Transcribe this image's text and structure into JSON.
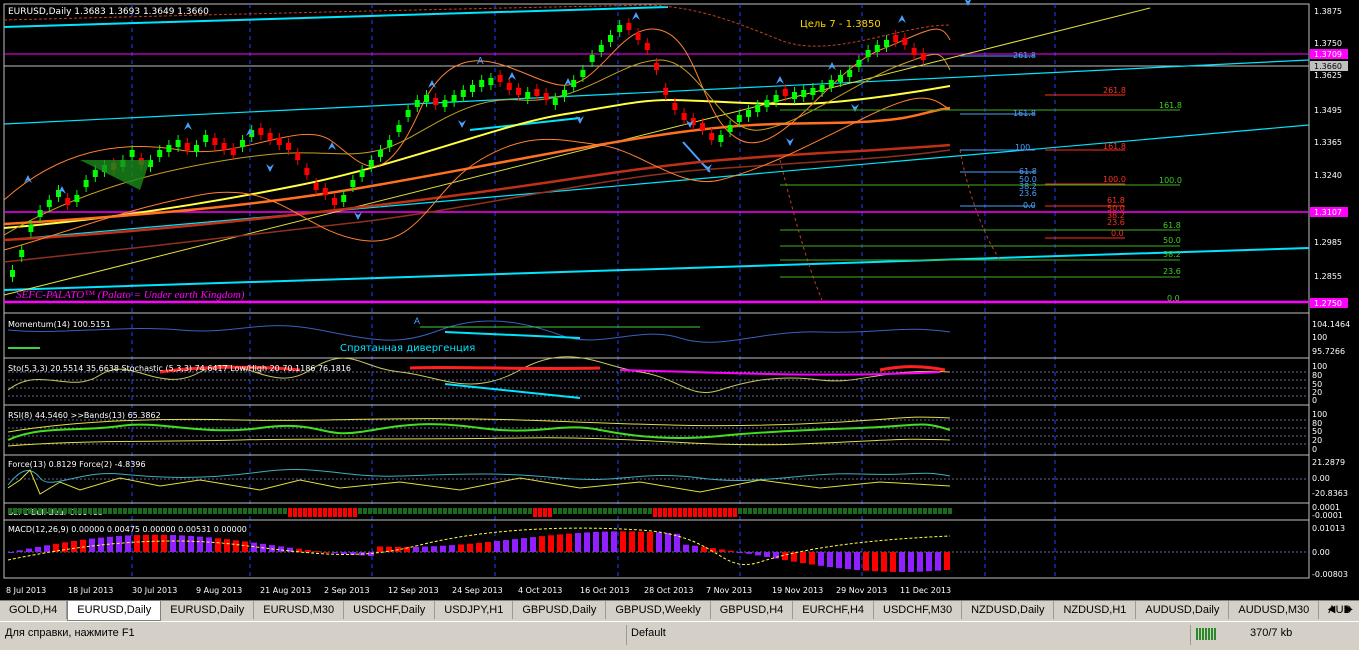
{
  "window": {
    "symbol_header": "EURUSD,Daily  1.3683 1.3693 1.3649 1.3660",
    "target_label": "Цель 7 - 1.3850",
    "watermark": "SEFC-PALATO™ (Palato = Under earth Kingdom)"
  },
  "price_axis": {
    "ticks": [
      "1.3875",
      "1.3750",
      "1.3625",
      "1.3495",
      "1.3365",
      "1.3240",
      "1.2985",
      "1.2855"
    ],
    "boxes": [
      {
        "label": "1.3709",
        "color": "#ff00ff"
      },
      {
        "label": "1.3660",
        "color": "#c0c0c0"
      },
      {
        "label": "1.3107",
        "color": "#ff00ff"
      },
      {
        "label": "1.2750",
        "color": "#ff00ff"
      }
    ]
  },
  "fib_labels": {
    "blue": [
      "261.8",
      "161.8",
      "100",
      "61.8",
      "50.0",
      "38.2",
      "23.6",
      "0.0"
    ],
    "red": [
      "261.8",
      "161.8",
      "100.0",
      "61.8",
      "50.0",
      "38.2",
      "23.6",
      "0.0"
    ],
    "green": [
      "161.8",
      "100.0",
      "61.8",
      "50.0",
      "38.2",
      "23.6",
      "0.0"
    ]
  },
  "date_axis": [
    "8 Jul 2013",
    "18 Jul 2013",
    "30 Jul 2013",
    "9 Aug 2013",
    "21 Aug 2013",
    "2 Sep 2013",
    "12 Sep 2013",
    "24 Sep 2013",
    "4 Oct 2013",
    "16 Oct 2013",
    "28 Oct 2013",
    "7 Nov 2013",
    "19 Nov 2013",
    "29 Nov 2013",
    "11 Dec 2013"
  ],
  "indicators": {
    "momentum": {
      "label": "Momentum(14) 100.5151",
      "ticks": [
        "104.1464",
        "100",
        "95.7266"
      ],
      "annotation": "Спрятанная дивергенция",
      "marker_a": "A"
    },
    "stochastic": {
      "label": "Sto(5,3,3) 20.5514 35.6638  Stochastic (5,3,3) 74,6417 Low/High 20  70.1186 76.1816",
      "ticks": [
        "100",
        "80",
        "50",
        "20",
        "0"
      ]
    },
    "rsi": {
      "label": "RSI(8) 44.5460  >>Bands(13) 65.3862",
      "ticks": [
        "100",
        "80",
        "50",
        "20",
        "0"
      ]
    },
    "force": {
      "label": "Force(13) 0.8129  Force(2) -4.8396",
      "ticks": [
        "21.2879",
        "0.00",
        "-20.8363"
      ]
    },
    "bullbear": {
      "label": "SEFC-Bull-Bear 0.00468",
      "ticks": [
        "0.0001",
        "-0.0001"
      ]
    },
    "macd": {
      "label": "MACD(12,26,9) 0.00000 0.00475 0.00000 0.00531 0.00000",
      "ticks": [
        "0.01013",
        "0.00",
        "-0.00803"
      ]
    }
  },
  "tabs": [
    "GOLD,H4",
    "EURUSD,Daily",
    "EURUSD,Daily",
    "EURUSD,M30",
    "USDCHF,Daily",
    "USDJPY,H1",
    "GBPUSD,Daily",
    "GBPUSD,Weekly",
    "GBPUSD,H4",
    "EURCHF,H4",
    "USDCHF,M30",
    "NZDUSD,Daily",
    "NZDUSD,H1",
    "AUDUSD,Daily",
    "AUDUSD,M30",
    "AUD"
  ],
  "active_tab": 1,
  "status": {
    "help": "Для справки, нажмите F1",
    "profile": "Default",
    "traffic": "370/7 kb"
  },
  "colors": {
    "bull_candle": "#00ff00",
    "bear_candle": "#ff0000",
    "grid": "#2040ff",
    "macd_up": "#9020ff",
    "macd_down": "#ff0000"
  }
}
